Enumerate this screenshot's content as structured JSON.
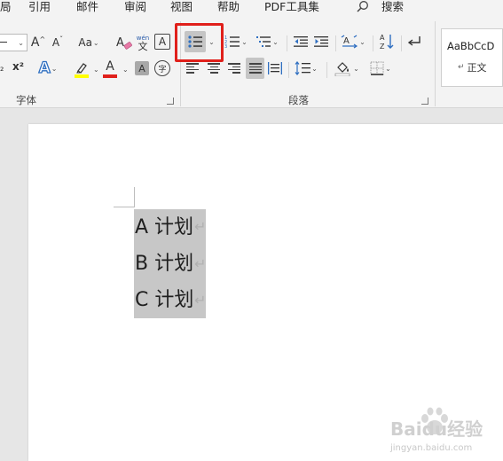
{
  "menu": {
    "items": [
      "局",
      "引用",
      "邮件",
      "审阅",
      "视图",
      "帮助",
      "PDF工具集"
    ],
    "search_label": "搜索"
  },
  "ribbon": {
    "font_group_label": "字体",
    "paragraph_group_label": "段落",
    "change_case_label": "Aa",
    "grow_font_glyph": "A",
    "shrink_font_glyph": "A",
    "phonetic_top": "wén",
    "phonetic_bottom": "文",
    "border_char_glyph": "A",
    "text_effects_glyph": "A",
    "font_color_glyph": "A",
    "char_shading_glyph": "A",
    "enclose_char_glyph": "字",
    "superscript_label": "x²",
    "subscript_label": "₂",
    "sort_label": "A↓Z",
    "highlight_color": "#ffff00",
    "font_color": "#e0201b"
  },
  "styles": {
    "preview_text": "AaBbCcD",
    "normal_label": "正文"
  },
  "document": {
    "lines": [
      "A 计划",
      "B 计划",
      "C 计划"
    ],
    "paragraph_mark": "↵"
  },
  "watermark": {
    "brand": "Baidu经验",
    "url": "jingyan.baidu.com"
  }
}
